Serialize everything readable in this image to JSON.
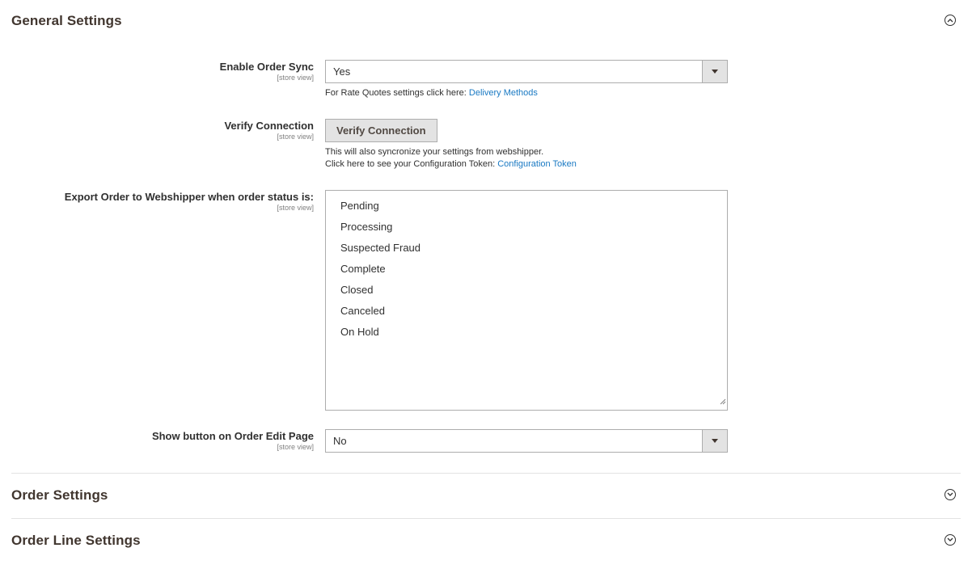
{
  "sections": {
    "general": {
      "title": "General Settings",
      "state": "expanded"
    },
    "order": {
      "title": "Order Settings",
      "state": "collapsed"
    },
    "order_line": {
      "title": "Order Line Settings",
      "state": "collapsed"
    }
  },
  "fields": {
    "enable_order_sync": {
      "label": "Enable Order Sync",
      "scope": "[store view]",
      "value": "Yes",
      "note_text": "For Rate Quotes settings click here: ",
      "note_link": "Delivery Methods"
    },
    "verify_connection": {
      "label": "Verify Connection",
      "scope": "[store view]",
      "button_label": "Verify Connection",
      "note_line1": "This will also syncronize your settings from webshipper.",
      "note_line2_text": "Click here to see your Configuration Token: ",
      "note_line2_link": "Configuration Token"
    },
    "export_order": {
      "label": "Export Order to Webshipper when order status is:",
      "scope": "[store view]",
      "options": [
        "Pending",
        "Processing",
        "Suspected Fraud",
        "Complete",
        "Closed",
        "Canceled",
        "On Hold"
      ]
    },
    "show_button": {
      "label": "Show button on Order Edit Page",
      "scope": "[store view]",
      "value": "No"
    }
  },
  "icons": {
    "section_expanded": "chevron-up-circle-icon",
    "section_collapsed": "chevron-down-circle-icon",
    "select_arrow": "caret-down-icon",
    "resize": "resize-handle-icon"
  },
  "colors": {
    "link": "#1979c3",
    "text": "#303030",
    "border": "#adadad",
    "button_bg": "#e3e3e3"
  }
}
